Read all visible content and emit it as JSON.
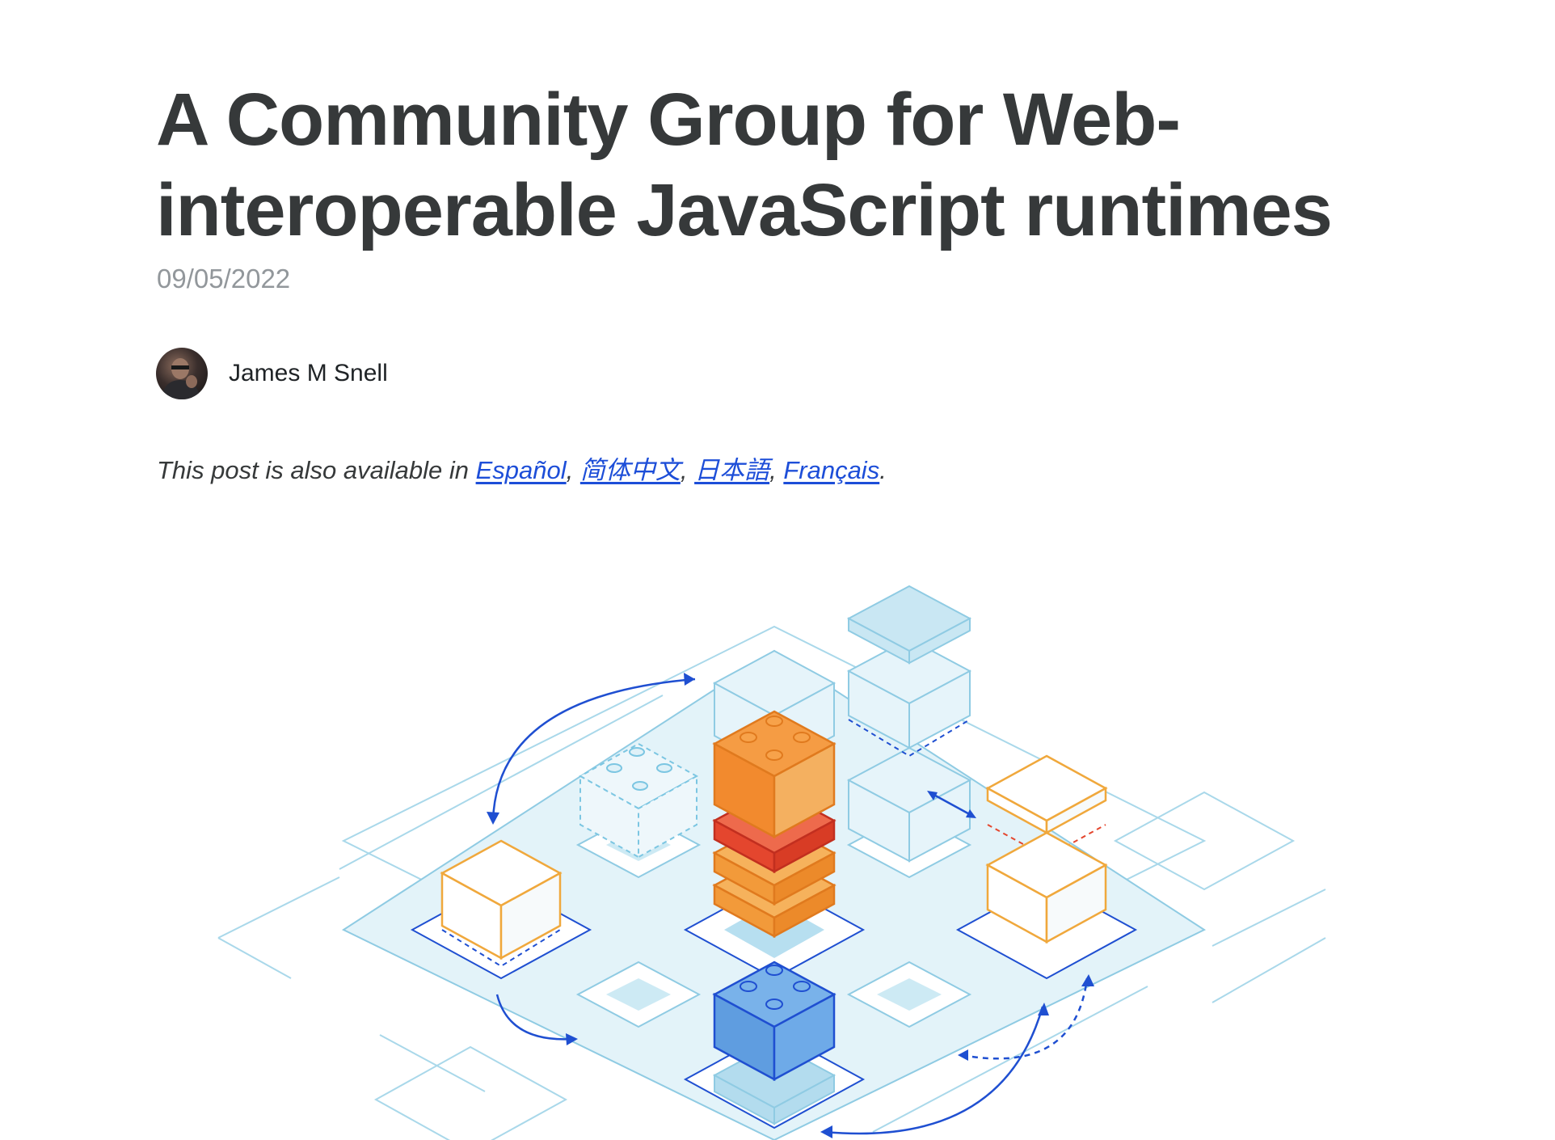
{
  "post": {
    "title": "A Community Group for Web-interoperable JavaScript runtimes",
    "date": "09/05/2022",
    "author": {
      "name": "James M Snell"
    },
    "translations": {
      "prefix": "This post is also available in ",
      "languages": [
        "Español",
        "简体中文",
        "日本語",
        "Français"
      ],
      "separator": ", ",
      "suffix": "."
    },
    "hero_image": {
      "icon": "building-blocks-illustration",
      "colors": {
        "light_blue": "#cdeaf4",
        "blue_line": "#8fcbe3",
        "dark_blue": "#1f4fd1",
        "orange": "#f29a3a",
        "red": "#e4462e",
        "lego_blue": "#5f9de0"
      }
    }
  }
}
